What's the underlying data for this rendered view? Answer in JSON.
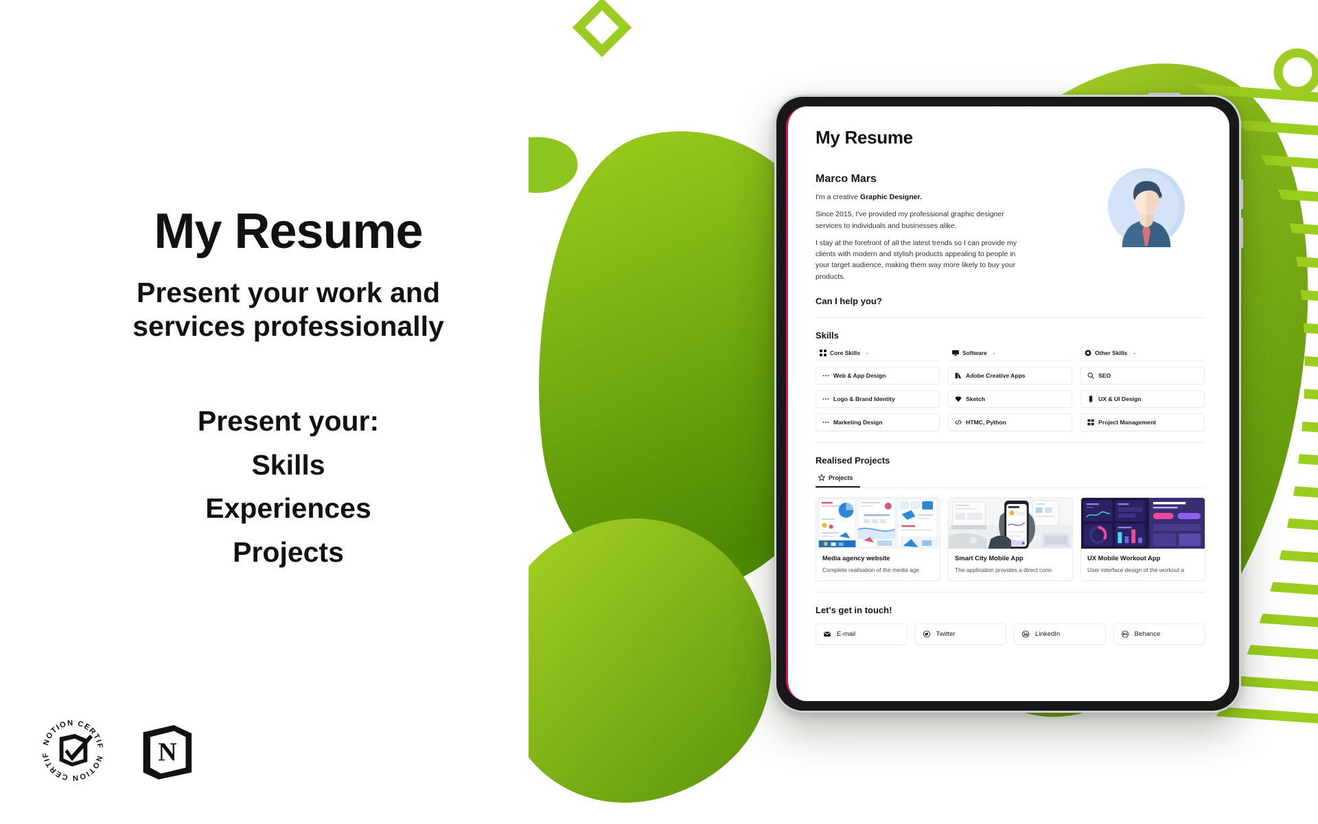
{
  "promo": {
    "headline": "My Resume",
    "subhead": "Present your work and services professionally",
    "present_label": "Present your:",
    "present_items": [
      "Skills",
      "Experiences",
      "Projects"
    ]
  },
  "badges": {
    "certified_text": "NOTION CERTIFIED",
    "certified_icon": "notion-certified-seal-icon",
    "logo_icon": "notion-logo-icon"
  },
  "resume": {
    "page_title": "My Resume",
    "name": "Marco Mars",
    "tagline_prefix": "I'm a creative ",
    "tagline_strong": "Graphic Designer.",
    "para1": "Since 2015, I've provided my professional graphic designer services to individuals and businesses alike.",
    "para2": "I stay at the forefront of all the latest trends so I can provide my clients with modern and stylish products appealing to people in your target audience, making them way more likely to buy your products.",
    "cta_heading": "Can I help you?",
    "avatar_icon": "user-avatar-illustration",
    "skills": {
      "heading": "Skills",
      "columns": [
        {
          "title": "Core Skills",
          "icon": "grid-squares-icon",
          "chevron": "chevron-down-icon",
          "items": [
            {
              "label": "Web & App Design",
              "icon": "ellipsis-icon"
            },
            {
              "label": "Logo & Brand Identity",
              "icon": "ellipsis-icon"
            },
            {
              "label": "Marketing Design",
              "icon": "ellipsis-icon"
            }
          ]
        },
        {
          "title": "Software",
          "icon": "monitor-icon",
          "chevron": "chevron-down-icon",
          "items": [
            {
              "label": "Adobe Creative Apps",
              "icon": "adobe-icon"
            },
            {
              "label": "Sketch",
              "icon": "sketch-diamond-icon"
            },
            {
              "label": "HTMC, Python",
              "icon": "code-icon"
            }
          ]
        },
        {
          "title": "Other Skills",
          "icon": "gear-icon",
          "chevron": "chevron-down-icon",
          "items": [
            {
              "label": "SEO",
              "icon": "search-icon"
            },
            {
              "label": "UX & UI Design",
              "icon": "mobile-icon"
            },
            {
              "label": "Project Management",
              "icon": "grid-blocks-icon"
            }
          ]
        }
      ]
    },
    "projects": {
      "heading": "Realised Projects",
      "tab_label": "Projects",
      "tab_icon": "star-icon",
      "cards": [
        {
          "title": "Media agency website",
          "desc": "Complete realisation of the media age",
          "thumb": "media-agency-mockup-thumbnail"
        },
        {
          "title": "Smart City Mobile App",
          "desc": "The application provides a direct conn",
          "thumb": "smart-city-phone-photo-thumbnail"
        },
        {
          "title": "UX Mobile Workout App",
          "desc": "User interface design of the workout a",
          "thumb": "workout-app-dark-ui-thumbnail"
        }
      ]
    },
    "contact": {
      "heading": "Let's get in touch!",
      "links": [
        {
          "label": "E-mail",
          "icon": "envelope-icon"
        },
        {
          "label": "Twitter",
          "icon": "twitter-icon"
        },
        {
          "label": "LinkedIn",
          "icon": "linkedin-icon"
        },
        {
          "label": "Behance",
          "icon": "behance-icon"
        }
      ]
    }
  },
  "colors": {
    "green_light": "#a5d028",
    "green_mid": "#8cc520",
    "green_dark": "#5d9206",
    "accent_red": "#e0144c",
    "text_dark": "#111111",
    "avatar_bg": "#c7dbf5"
  }
}
